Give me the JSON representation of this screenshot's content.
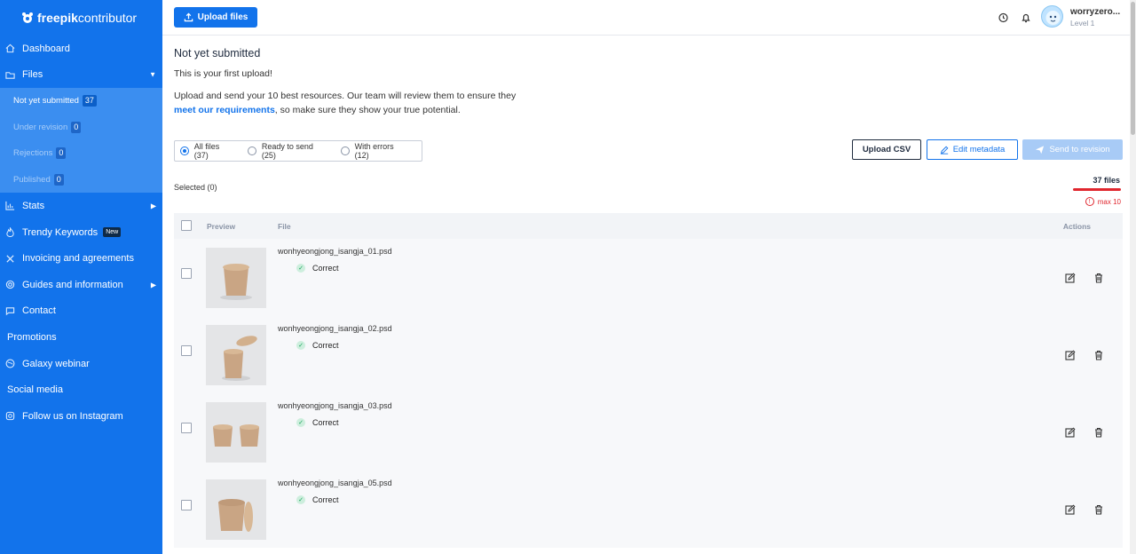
{
  "brand": {
    "bold": "freepik",
    "light": "contributor"
  },
  "sidebar": {
    "items": [
      {
        "label": "Dashboard",
        "icon": "home-icon"
      },
      {
        "label": "Files",
        "icon": "folder-icon"
      }
    ],
    "files_sub": [
      {
        "label": "Not yet submitted",
        "count": "37"
      },
      {
        "label": "Under revision",
        "count": "0"
      },
      {
        "label": "Rejections",
        "count": "0"
      },
      {
        "label": "Published",
        "count": "0"
      }
    ],
    "items2": [
      {
        "label": "Stats",
        "icon": "chart-icon"
      },
      {
        "label": "Trendy Keywords",
        "icon": "flame-icon",
        "badge": "New"
      },
      {
        "label": "Invoicing and agreements",
        "icon": "tools-icon"
      },
      {
        "label": "Guides and information",
        "icon": "lifebuoy-icon"
      },
      {
        "label": "Contact",
        "icon": "chat-icon"
      }
    ],
    "promotions": "Promotions",
    "galaxy": "Galaxy webinar",
    "social": "Social media",
    "instagram": "Follow us on Instagram"
  },
  "header": {
    "upload_label": "Upload files",
    "user_name": "worryzero...",
    "user_level": "Level 1"
  },
  "main": {
    "title": "Not yet submitted",
    "first_upload": "This is your first upload!",
    "intro_text": "Upload and send your 10 best resources. Our team will review them to ensure they",
    "intro_link": "meet our requirements",
    "intro_tail": ", so make sure they show your true potential.",
    "filters": [
      "All files (37)",
      "Ready to send (25)",
      "With errors (12)"
    ],
    "upload_csv": "Upload CSV",
    "edit_metadata": "Edit metadata",
    "send_revision": "Send to revision",
    "selected": "Selected (0)",
    "files_count": "37 files",
    "max": "max 10",
    "columns": {
      "preview": "Preview",
      "file": "File",
      "actions": "Actions"
    },
    "rows": [
      {
        "name": "wonhyeongjong_isangja_01.psd",
        "status": "Correct"
      },
      {
        "name": "wonhyeongjong_isangja_02.psd",
        "status": "Correct"
      },
      {
        "name": "wonhyeongjong_isangja_03.psd",
        "status": "Correct"
      },
      {
        "name": "wonhyeongjong_isangja_05.psd",
        "status": "Correct"
      }
    ]
  }
}
